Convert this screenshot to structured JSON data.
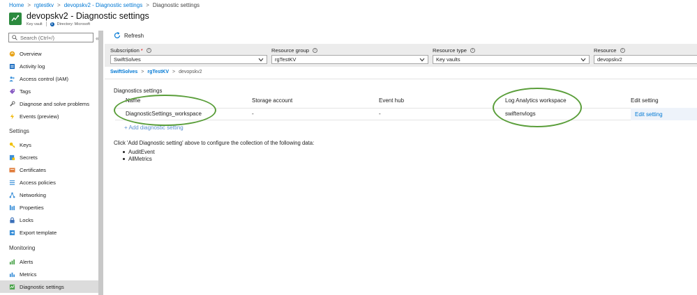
{
  "breadcrumb": {
    "items": [
      "Home",
      "rgtestkv",
      "devopskv2 - Diagnostic settings",
      "Diagnostic settings"
    ]
  },
  "header": {
    "title": "devopskv2 - Diagnostic settings",
    "resource_type": "Key vault",
    "directory": "Directory: Microsoft"
  },
  "sidebar": {
    "search_placeholder": "Search (Ctrl+/)",
    "collapse_glyph": "«",
    "items_top": [
      {
        "label": "Overview",
        "icon": "overview-icon"
      },
      {
        "label": "Activity log",
        "icon": "activity-log-icon"
      },
      {
        "label": "Access control (IAM)",
        "icon": "people-icon"
      },
      {
        "label": "Tags",
        "icon": "tag-icon"
      },
      {
        "label": "Diagnose and solve problems",
        "icon": "wrench-icon"
      },
      {
        "label": "Events (preview)",
        "icon": "lightning-icon"
      }
    ],
    "section_settings": "Settings",
    "items_settings": [
      {
        "label": "Keys",
        "icon": "key-icon"
      },
      {
        "label": "Secrets",
        "icon": "secret-icon"
      },
      {
        "label": "Certificates",
        "icon": "certificate-icon"
      },
      {
        "label": "Access policies",
        "icon": "access-policies-icon"
      },
      {
        "label": "Networking",
        "icon": "network-icon"
      },
      {
        "label": "Properties",
        "icon": "properties-icon"
      },
      {
        "label": "Locks",
        "icon": "lock-icon"
      },
      {
        "label": "Export template",
        "icon": "export-icon"
      }
    ],
    "section_monitoring": "Monitoring",
    "items_monitoring": [
      {
        "label": "Alerts",
        "icon": "alert-icon"
      },
      {
        "label": "Metrics",
        "icon": "metrics-icon"
      },
      {
        "label": "Diagnostic settings",
        "icon": "diagnostic-icon",
        "active": true
      }
    ]
  },
  "toolbar": {
    "refresh_label": "Refresh"
  },
  "filters": {
    "subscription": {
      "label": "Subscription",
      "required_mark": "*",
      "value": "SwiftSolves"
    },
    "resource_group": {
      "label": "Resource group",
      "value": "rgTestKV"
    },
    "resource_type": {
      "label": "Resource type",
      "value": "Key vaults"
    },
    "resource": {
      "label": "Resource",
      "value": "devopskv2"
    }
  },
  "sub_breadcrumb": [
    "SwiftSolves",
    "rgTestKV",
    "devopskv2"
  ],
  "diagnostics": {
    "section_title": "Diagnostics settings",
    "columns": [
      "Name",
      "Storage account",
      "Event hub",
      "Log Analytics workspace",
      "Edit setting"
    ],
    "rows": [
      [
        "DiagnosticSettings_workspace",
        "-",
        "-",
        "swiftenvlogs",
        "Edit setting"
      ]
    ],
    "add_link": "+ Add diagnostic setting",
    "hint": "Click 'Add Diagnostic setting' above to configure the collection of the following data:",
    "data_items": [
      "AuditEvent",
      "AllMetrics"
    ]
  },
  "colors": {
    "accent": "#0078d4",
    "highlight_ellipse": "#5a9e3a",
    "active_nav": "#dcdcdc",
    "filter_strip": "#ececec"
  }
}
